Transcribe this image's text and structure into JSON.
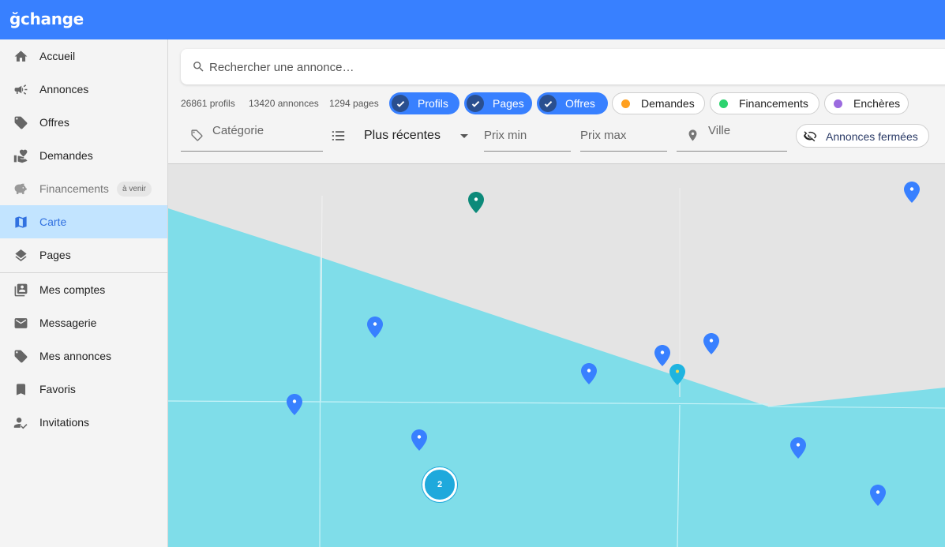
{
  "app": {
    "brand": "ğchange"
  },
  "sidebar": {
    "items": [
      {
        "label": "Accueil",
        "icon": "home-icon"
      },
      {
        "label": "Annonces",
        "icon": "megaphone-icon"
      },
      {
        "label": "Offres",
        "icon": "tag-icon"
      },
      {
        "label": "Demandes",
        "icon": "hand-heart-icon"
      },
      {
        "label": "Financements",
        "icon": "piggy-bank-icon",
        "badge": "à venir",
        "disabled": true
      },
      {
        "label": "Carte",
        "icon": "map-icon",
        "active": true
      },
      {
        "label": "Pages",
        "icon": "layers-icon"
      }
    ],
    "items2": [
      {
        "label": "Mes comptes",
        "icon": "wallet-icon"
      },
      {
        "label": "Messagerie",
        "icon": "mail-icon"
      },
      {
        "label": "Mes annonces",
        "icon": "tag-icon"
      },
      {
        "label": "Favoris",
        "icon": "bookmark-icon"
      },
      {
        "label": "Invitations",
        "icon": "user-check-icon"
      }
    ]
  },
  "search": {
    "placeholder": "Rechercher une annonce…"
  },
  "stats": {
    "profiles": "26861 profils",
    "ads": "13420 annonces",
    "pages": "1294 pages"
  },
  "filters": {
    "chips": [
      {
        "label": "Profils",
        "checked": true
      },
      {
        "label": "Pages",
        "checked": true
      },
      {
        "label": "Offres",
        "checked": true
      },
      {
        "label": "Demandes",
        "checked": false,
        "color": "#ffa01f"
      },
      {
        "label": "Financements",
        "checked": false,
        "color": "#2dd36f"
      },
      {
        "label": "Enchères",
        "checked": false,
        "color": "#9b6bdf"
      }
    ],
    "category": "Catégorie",
    "sort": "Plus récentes",
    "price_min": "Prix min",
    "price_max": "Prix max",
    "city": "Ville",
    "closed_button": "Annonces fermées"
  },
  "map": {
    "cluster_count": "2",
    "pin_colors": {
      "profile": "#3880ff",
      "page": "#0d8a7a",
      "offer": "#1fb4e0"
    }
  },
  "colors": {
    "primary": "#3880ff",
    "active_bg": "#c2e4ff",
    "water": "#7fdde9",
    "land": "#e4e4e4"
  }
}
